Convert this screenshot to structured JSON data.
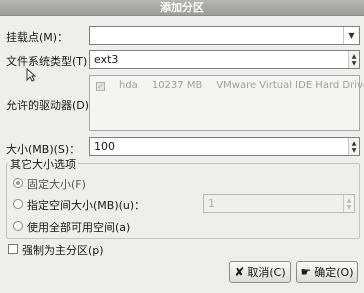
{
  "window": {
    "title": "添加分区"
  },
  "mount_point": {
    "label": "挂载点(M)：",
    "value": ""
  },
  "fs_type": {
    "label": "文件系统类型(T)：",
    "value": "ext3"
  },
  "drives": {
    "label": "允许的驱动器(D)：",
    "rows": [
      {
        "name": "hda",
        "size": "10237 MB",
        "model": "VMware Virtual IDE Hard Drive",
        "checked": true
      }
    ]
  },
  "size": {
    "label": "大小(MB)(S)：",
    "value": "100"
  },
  "other_size": {
    "title": "其它大小选项",
    "fixed_label": "固定大小(F)",
    "fill_upto_label": "指定空间大小(MB)(u)：",
    "fill_upto_value": "1",
    "fill_all_label": "使用全部可用空间(a)",
    "selected": "fixed"
  },
  "primary": {
    "label": "强制为主分区(p)",
    "checked": false
  },
  "buttons": {
    "cancel": "取消(C)",
    "ok": "确定(O)"
  },
  "icons": {
    "cancel": "x-icon",
    "ok": "hand-ok-icon",
    "cursor": "mouse-pointer-icon"
  }
}
